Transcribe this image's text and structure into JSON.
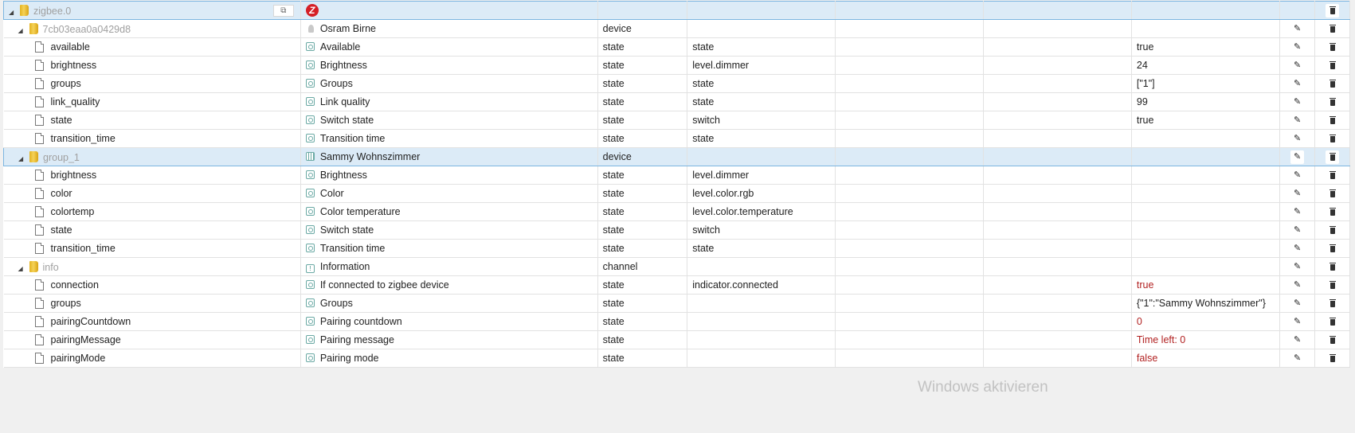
{
  "root": {
    "id": "zigbee.0",
    "logo_icon": "zigbee-z-logo"
  },
  "rows": [
    {
      "type": "folder",
      "level": 1,
      "id": "7cb03eaa0a0429d8",
      "name": "Osram Birne",
      "role_type": "device",
      "role": "",
      "value": "",
      "value_red": false,
      "icon": "bulb"
    },
    {
      "type": "state",
      "level": 2,
      "id": "available",
      "name": "Available",
      "role_type": "state",
      "role": "state",
      "value": "true",
      "value_red": false,
      "icon": "state"
    },
    {
      "type": "state",
      "level": 2,
      "id": "brightness",
      "name": "Brightness",
      "role_type": "state",
      "role": "level.dimmer",
      "value": "24",
      "value_red": false,
      "icon": "state"
    },
    {
      "type": "state",
      "level": 2,
      "id": "groups",
      "name": "Groups",
      "role_type": "state",
      "role": "state",
      "value": "[\"1\"]",
      "value_red": false,
      "icon": "state"
    },
    {
      "type": "state",
      "level": 2,
      "id": "link_quality",
      "name": "Link quality",
      "role_type": "state",
      "role": "state",
      "value": "99",
      "value_red": false,
      "icon": "state"
    },
    {
      "type": "state",
      "level": 2,
      "id": "state",
      "name": "Switch state",
      "role_type": "state",
      "role": "switch",
      "value": "true",
      "value_red": false,
      "icon": "state"
    },
    {
      "type": "state",
      "level": 2,
      "id": "transition_time",
      "name": "Transition time",
      "role_type": "state",
      "role": "state",
      "value": "",
      "value_red": false,
      "icon": "state"
    },
    {
      "type": "folder",
      "level": 1,
      "id": "group_1",
      "name": "Sammy Wohnszimmer",
      "role_type": "device",
      "role": "",
      "value": "",
      "value_red": false,
      "icon": "grp",
      "selected": true
    },
    {
      "type": "state",
      "level": 2,
      "id": "brightness",
      "name": "Brightness",
      "role_type": "state",
      "role": "level.dimmer",
      "value": "",
      "value_red": false,
      "icon": "state"
    },
    {
      "type": "state",
      "level": 2,
      "id": "color",
      "name": "Color",
      "role_type": "state",
      "role": "level.color.rgb",
      "value": "",
      "value_red": false,
      "icon": "state"
    },
    {
      "type": "state",
      "level": 2,
      "id": "colortemp",
      "name": "Color temperature",
      "role_type": "state",
      "role": "level.color.temperature",
      "value": "",
      "value_red": false,
      "icon": "state"
    },
    {
      "type": "state",
      "level": 2,
      "id": "state",
      "name": "Switch state",
      "role_type": "state",
      "role": "switch",
      "value": "",
      "value_red": false,
      "icon": "state"
    },
    {
      "type": "state",
      "level": 2,
      "id": "transition_time",
      "name": "Transition time",
      "role_type": "state",
      "role": "state",
      "value": "",
      "value_red": false,
      "icon": "state"
    },
    {
      "type": "folder",
      "level": 1,
      "id": "info",
      "name": "Information",
      "role_type": "channel",
      "role": "",
      "value": "",
      "value_red": false,
      "icon": "channel"
    },
    {
      "type": "state",
      "level": 2,
      "id": "connection",
      "name": "If connected to zigbee device",
      "role_type": "state",
      "role": "indicator.connected",
      "value": "true",
      "value_red": true,
      "icon": "state"
    },
    {
      "type": "state",
      "level": 2,
      "id": "groups",
      "name": "Groups",
      "role_type": "state",
      "role": "",
      "value": "{\"1\":\"Sammy Wohnszimmer\"}",
      "value_red": false,
      "icon": "state"
    },
    {
      "type": "state",
      "level": 2,
      "id": "pairingCountdown",
      "name": "Pairing countdown",
      "role_type": "state",
      "role": "",
      "value": "0",
      "value_red": true,
      "icon": "state"
    },
    {
      "type": "state",
      "level": 2,
      "id": "pairingMessage",
      "name": "Pairing message",
      "role_type": "state",
      "role": "",
      "value": "Time left: 0",
      "value_red": true,
      "icon": "state"
    },
    {
      "type": "state",
      "level": 2,
      "id": "pairingMode",
      "name": "Pairing mode",
      "role_type": "state",
      "role": "",
      "value": "false",
      "value_red": true,
      "icon": "state"
    }
  ],
  "watermark": "Windows aktivieren",
  "colors": {
    "selected_bg": "#dcebf7",
    "value_red": "#b22222",
    "folder_text": "#a0a0a0"
  }
}
